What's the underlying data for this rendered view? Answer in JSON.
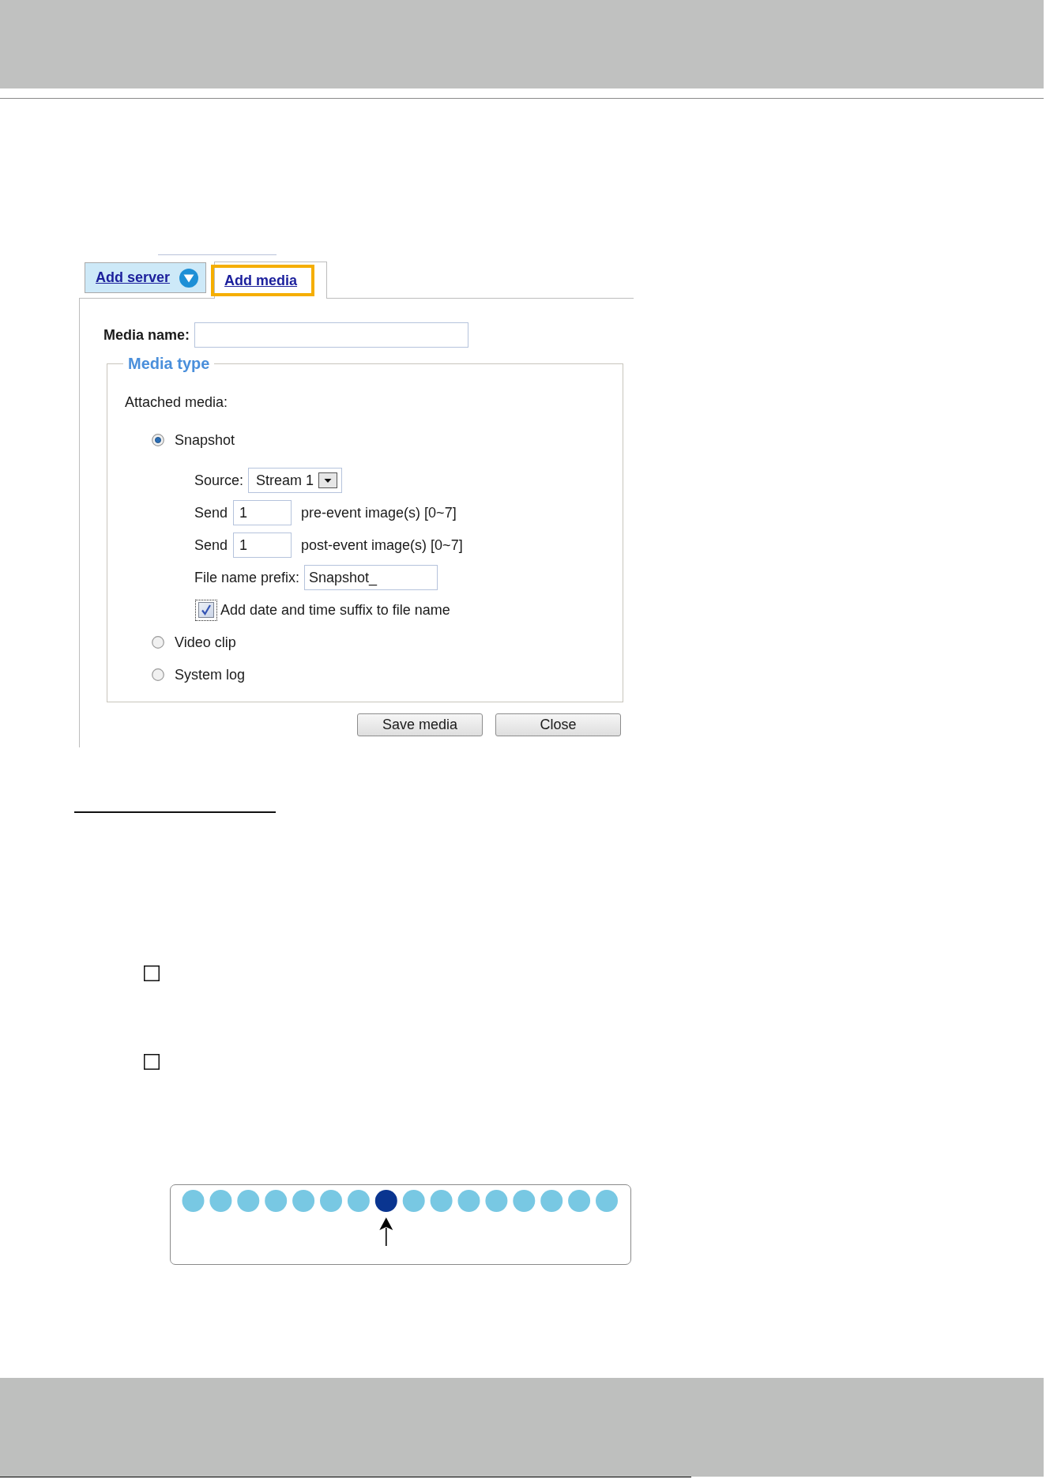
{
  "tabs": [
    {
      "label": "Add server",
      "kind": "menu",
      "selected": false,
      "highlighted": false
    },
    {
      "label": "Add media",
      "kind": "plain",
      "selected": true,
      "highlighted": true
    }
  ],
  "media_name": {
    "label": "Media name:"
  },
  "media_type": {
    "legend": "Media type",
    "intro": "Attached media:",
    "options": [
      {
        "label": "Snapshot",
        "selected": true,
        "settings": {
          "source": {
            "label": "Source:",
            "value": "Stream 1"
          },
          "send": [
            {
              "label": "Send",
              "value": "1",
              "hint": "pre-event image(s) [0~7]"
            },
            {
              "label": "Send",
              "value": "1",
              "hint": "post-event image(s) [0~7]"
            }
          ],
          "prefix": {
            "label": "File name prefix:",
            "value": "Snapshot_"
          },
          "date_suffix": {
            "label": "Add date and time suffix to file name",
            "checked": true,
            "focused": true
          }
        }
      },
      {
        "label": "Video clip",
        "selected": false
      },
      {
        "label": "System log",
        "selected": false
      }
    ]
  },
  "buttons": [
    "Save media",
    "Close"
  ],
  "check_boxes": [
    {
      "checked": false
    },
    {
      "checked": false
    }
  ],
  "diagram": {
    "dots": [
      {
        "color": "#78c8e3",
        "selected": false
      },
      {
        "color": "#78c8e3",
        "selected": false
      },
      {
        "color": "#78c8e3",
        "selected": false
      },
      {
        "color": "#78c8e3",
        "selected": false
      },
      {
        "color": "#78c8e3",
        "selected": false
      },
      {
        "color": "#78c8e3",
        "selected": false
      },
      {
        "color": "#78c8e3",
        "selected": false
      },
      {
        "color": "#0a3590",
        "selected": true
      },
      {
        "color": "#78c8e3",
        "selected": false
      },
      {
        "color": "#78c8e3",
        "selected": false
      },
      {
        "color": "#78c8e3",
        "selected": false
      },
      {
        "color": "#78c8e3",
        "selected": false
      },
      {
        "color": "#78c8e3",
        "selected": false
      },
      {
        "color": "#78c8e3",
        "selected": false
      },
      {
        "color": "#78c8e3",
        "selected": false
      },
      {
        "color": "#78c8e3",
        "selected": false
      }
    ]
  }
}
